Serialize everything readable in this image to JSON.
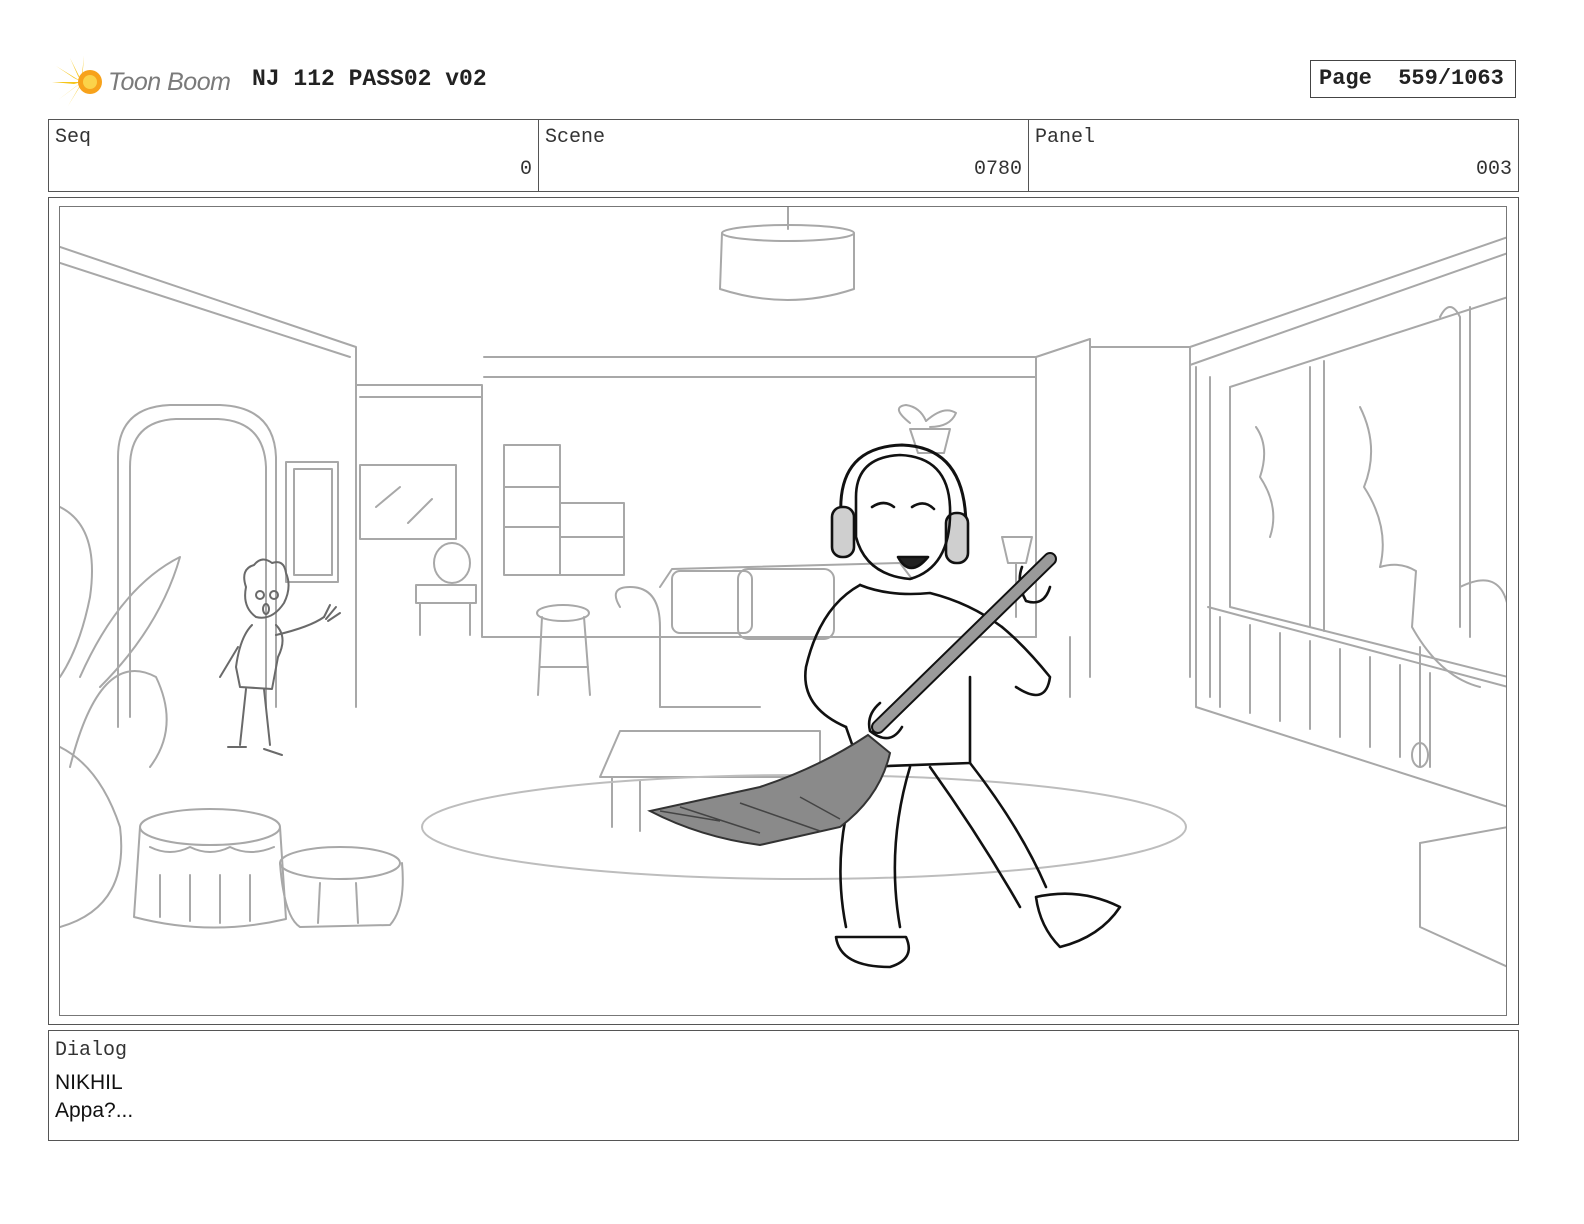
{
  "header": {
    "logo_text": "Toon Boom",
    "title": "NJ 112 PASS02 v02",
    "page_label": "Page",
    "page_number": "559/1063"
  },
  "info": {
    "seq_label": "Seq",
    "seq_value": "0",
    "scene_label": "Scene",
    "scene_value": "0780",
    "panel_label": "Panel",
    "panel_value": "003"
  },
  "dialog": {
    "label": "Dialog",
    "speaker": "NIKHIL",
    "line": "Appa?..."
  }
}
